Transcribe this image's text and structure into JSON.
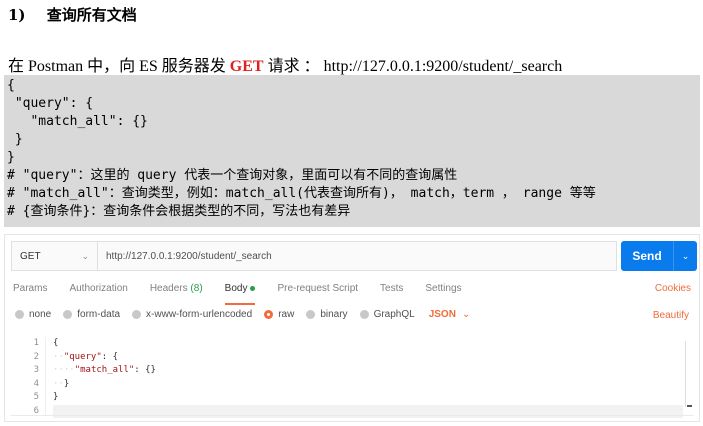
{
  "heading": {
    "number": "1)",
    "title": "查询所有文档"
  },
  "intro": {
    "before": "在 Postman 中，向 ES 服务器发 ",
    "method": "GET",
    "after": " 请求 ： http://127.0.0.1:9200/student/_search"
  },
  "code_lines": [
    "{",
    " \"query\": {",
    "   \"match_all\": {}",
    " }",
    "}",
    "# \"query\"：这里的 query 代表一个查询对象，里面可以有不同的查询属性",
    "# \"match_all\"：查询类型，例如：match_all(代表查询所有)， match，term ， range 等等",
    "# {查询条件}：查询条件会根据类型的不同，写法也有差异"
  ],
  "postman": {
    "method": "GET",
    "url": "http://127.0.0.1:9200/student/_search",
    "send_label": "Send",
    "tabs": {
      "params": "Params",
      "authorization": "Authorization",
      "headers": "Headers",
      "headers_count": "(8)",
      "body": "Body",
      "pre_request": "Pre-request Script",
      "tests": "Tests",
      "settings": "Settings"
    },
    "cookies": "Cookies",
    "body_options": {
      "none": "none",
      "form_data": "form-data",
      "urlencoded": "x-www-form-urlencoded",
      "raw": "raw",
      "binary": "binary",
      "graphql": "GraphQL",
      "format": "JSON"
    },
    "beautify": "Beautify",
    "editor": {
      "line_numbers": [
        "1",
        "2",
        "3",
        "4",
        "5",
        "6"
      ],
      "open_brace": "{",
      "query_key": "\"query\"",
      "colon_open": ": {",
      "match_all_key": "\"match_all\"",
      "colon_empty": ": {}",
      "inner_close": "}",
      "outer_close": "}"
    }
  }
}
